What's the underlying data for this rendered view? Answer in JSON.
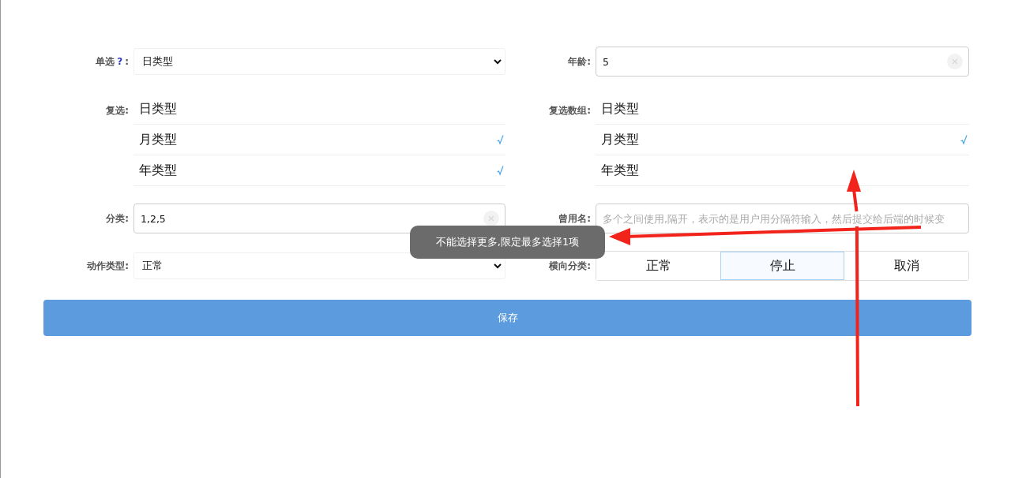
{
  "fields": [
    {
      "kind": "select",
      "label": "单选",
      "help": "?",
      "colon": ":",
      "value": "日类型"
    },
    {
      "kind": "input",
      "label": "年龄:",
      "value": "5",
      "clearable": true
    },
    {
      "kind": "checklist",
      "label": "复选:",
      "options": [
        {
          "text": "日类型",
          "checked": false
        },
        {
          "text": "月类型",
          "checked": true
        },
        {
          "text": "年类型",
          "checked": true
        }
      ]
    },
    {
      "kind": "checklist",
      "label": "复选数组:",
      "options": [
        {
          "text": "日类型",
          "checked": false
        },
        {
          "text": "月类型",
          "checked": true
        },
        {
          "text": "年类型",
          "checked": false
        }
      ]
    },
    {
      "kind": "input",
      "label": "分类:",
      "value": "1,2,5",
      "clearable": true
    },
    {
      "kind": "input",
      "label": "曾用名:",
      "placeholder": "多个之间使用,隔开，表示的是用户用分隔符输入，然后提交给后端的时候变",
      "clearable": false
    },
    {
      "kind": "select",
      "label": "动作类型:",
      "value": "正常"
    },
    {
      "kind": "segmented",
      "label": "横向分类:",
      "options": [
        {
          "text": "正常",
          "selected": false
        },
        {
          "text": "停止",
          "selected": true
        },
        {
          "text": "取消",
          "selected": false
        }
      ]
    }
  ],
  "save_button": "保存",
  "toast": "不能选择更多,限定最多选择1项",
  "annotations": [
    {
      "kind": "arrow"
    },
    {
      "kind": "arrow"
    }
  ]
}
